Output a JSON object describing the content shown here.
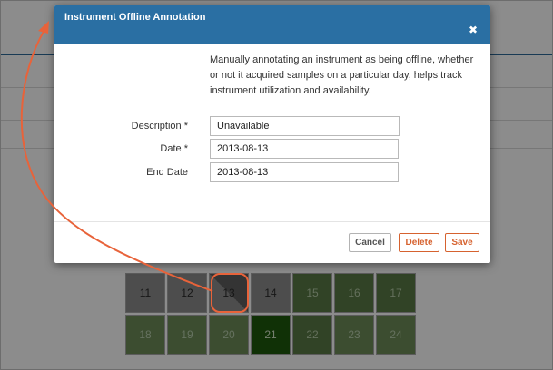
{
  "dialog": {
    "title": "Instrument Offline Annotation",
    "close_icon": "close-icon",
    "description": "Manually annotating an instrument as being offline, whether or not it acquired samples on a particular day, helps track instrument utilization and availability.",
    "fields": {
      "description": {
        "label": "Description *",
        "value": "Unavailable"
      },
      "date": {
        "label": "Date *",
        "value": "2013-08-13"
      },
      "end_date": {
        "label": "End Date",
        "value": "2013-08-13"
      }
    },
    "buttons": {
      "cancel": "Cancel",
      "delete": "Delete",
      "save": "Save"
    }
  },
  "calendar": {
    "row1": [
      "11",
      "12",
      "13",
      "14",
      "15",
      "16",
      "17"
    ],
    "row2": [
      "18",
      "19",
      "20",
      "21",
      "22",
      "23",
      "24"
    ],
    "selected_day": "13"
  },
  "colors": {
    "header_blue": "#2a6fa3",
    "accent_orange": "#d6622f",
    "callout_orange": "#e8633a",
    "green_day": "#6e8c58",
    "dark_green_day": "#1e5a0b"
  }
}
